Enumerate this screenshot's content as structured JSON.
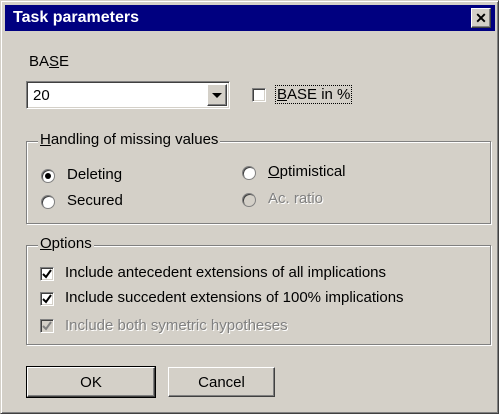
{
  "window": {
    "title": "Task parameters",
    "close_glyph": "✕"
  },
  "base": {
    "label_prefix": "BA",
    "label_accel": "S",
    "label_suffix": "E",
    "value": "20",
    "in_percent": {
      "prefix": "",
      "accel": "B",
      "suffix": "ASE in %",
      "checked": false
    }
  },
  "missing_values": {
    "legend_accel": "H",
    "legend_rest": "andling of missing values",
    "options": [
      {
        "label": "Deleting",
        "selected": true,
        "enabled": true
      },
      {
        "label": "Optimistical",
        "accel": "O",
        "label_rest": "ptimistical",
        "selected": false,
        "enabled": true
      },
      {
        "label": "Secured",
        "selected": false,
        "enabled": true
      },
      {
        "label": "Ac. ratio",
        "selected": false,
        "enabled": false
      }
    ]
  },
  "options": {
    "legend_accel": "O",
    "legend_rest": "ptions",
    "items": [
      {
        "label": "Include antecedent extensions of all implications",
        "checked": true,
        "enabled": true
      },
      {
        "label": "Include succedent extensions of 100% implications",
        "checked": true,
        "enabled": true
      },
      {
        "label": "Include both symetric hypotheses",
        "checked": true,
        "enabled": false
      }
    ]
  },
  "buttons": {
    "ok": "OK",
    "cancel": "Cancel"
  },
  "colors": {
    "face": "#d4d0c8",
    "titlebar": "#000080",
    "disabled_text": "#808080"
  }
}
